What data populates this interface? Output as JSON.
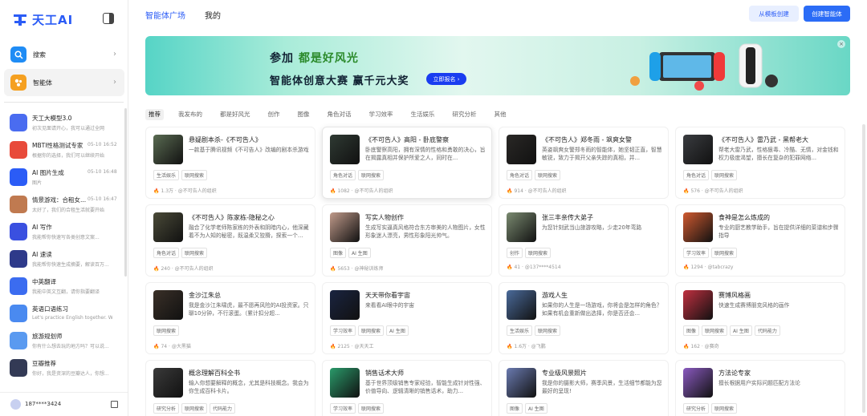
{
  "brand": {
    "name": "天工AI"
  },
  "sidebar": {
    "nav": [
      {
        "label": "搜索",
        "icon": "search-icon",
        "color": "#1f8cf5"
      },
      {
        "label": "智能体",
        "icon": "agent-icon",
        "color": "#f5a020"
      }
    ],
    "chats": [
      {
        "title": "天工大模型3.0",
        "time": "",
        "sub": "初次见面请开心，我可以通过全网",
        "color": "#4a6cf0"
      },
      {
        "title": "MBTI性格测试专家",
        "time": "05-10 16:52",
        "sub": "根据你的选择，我们可以继续开始",
        "color": "#e84a3a"
      },
      {
        "title": "AI 图片生成",
        "time": "05-10 16:48",
        "sub": "图片",
        "color": "#2b5cf6"
      },
      {
        "title": "情景游戏：合租女...",
        "time": "05-10 16:47",
        "sub": "太好了，我们的合租生活就要开始",
        "color": "#c07a50"
      },
      {
        "title": "AI 写作",
        "time": "",
        "sub": "我能帮你快速写各类创意文案...",
        "color": "#3a50e0"
      },
      {
        "title": "AI 速读",
        "time": "",
        "sub": "我能帮你快速生成摘要，解读百万...",
        "color": "#2e3a8a"
      },
      {
        "title": "中英翻译",
        "time": "",
        "sub": "我能中英文互翻，请你指要翻译",
        "color": "#3b6cf0"
      },
      {
        "title": "英语口语练习",
        "time": "",
        "sub": "Let's practice English together. W...",
        "color": "#4a8af0"
      },
      {
        "title": "旅游规划师",
        "time": "",
        "sub": "你有什么想去玩的地方吗？可以说...",
        "color": "#5a9af0"
      },
      {
        "title": "豆瓣推荐",
        "time": "",
        "sub": "你好，我是资深的豆瓣达人，你想...",
        "color": "#333a55"
      }
    ],
    "user": {
      "name": "187****3424"
    }
  },
  "topbar": {
    "tabs": [
      "智能体广场",
      "我的"
    ],
    "tpl_btn": "从模板创建",
    "create_btn": "创建智能体"
  },
  "banner": {
    "line1a": "参加",
    "line1b": "都是好风光",
    "line2": "智能体创意大赛 赢千元大奖",
    "btn": "立即报名 ›",
    "close": "×"
  },
  "categories": [
    "推荐",
    "我发布的",
    "都是好风光",
    "创作",
    "图像",
    "角色对话",
    "学习效率",
    "生活娱乐",
    "研究分析",
    "其他"
  ],
  "cards": [
    {
      "title": "悬疑剧本杀-《不可告人》",
      "desc": "一款基于腾讯视频《不可告人》改编的剧本杀游戏",
      "tags": [
        "生活娱乐",
        "联网搜索"
      ],
      "stats": "1.3万 · @不可告人的组织",
      "color": "#5a6b52"
    },
    {
      "title": "《不可告人》高阳 - 卧底警察",
      "desc": "卧底警察高阳，拥有深情的性格和勇敢的决心，旨在揭露真相并保护所爱之人，同时在...",
      "tags": [
        "角色对话",
        "联网搜索"
      ],
      "stats": "1082 · @不可告人的组织",
      "color": "#2f3a33"
    },
    {
      "title": "《不可告人》郑冬雨 - 飒爽女警",
      "desc": "英姿飒爽女警郑冬雨的智能体，她坚韧正直，智慧敏锐，致力于揭开父亲失踪的真相，并...",
      "tags": [
        "角色对话",
        "联网搜索"
      ],
      "stats": "914 · @不可告人的组织",
      "color": "#2a2826"
    },
    {
      "title": "《不可告人》雷乃武 - 黑帮老大",
      "desc": "帮老大雷乃武，性格狠毒、冷酷、无情，对金钱和权力极度渴望，擅长在复杂的犯罪网络...",
      "tags": [
        "角色对话",
        "联网搜索"
      ],
      "stats": "576 · @不可告人的组织",
      "color": "#3a3c40"
    },
    {
      "title": "《不可告人》陈家栋-隐秘之心",
      "desc": "融合了化学老师陈家栋的外表和阴暗内心，他深藏着不为人知的秘密，既温柔又狡猾，探索一个...",
      "tags": [
        "角色对话",
        "联网搜索"
      ],
      "stats": "240 · @不可告人的组织",
      "color": "#4a4a38"
    },
    {
      "title": "写实人物创作",
      "desc": "生成写实逼真风格符合东方审美的人物图片，女性形象迷人漂亮，男性形象阳光帅气。",
      "tags": [
        "图像",
        "AI 生图"
      ],
      "stats": "5653 · @神秘训练师",
      "color": "#c09a8a"
    },
    {
      "title": "张三丰亲传大弟子",
      "desc": "为您针刻武当山旅游攻略，少走20年弯路",
      "tags": [
        "创作",
        "联网搜索"
      ],
      "stats": "41 · @137****4514",
      "color": "#7a8a70"
    },
    {
      "title": "食神是怎么炼成的",
      "desc": "专业的厨艺教学助手，旨在提供详细的菜谱和步骤指导",
      "tags": [
        "学习效率",
        "联网搜索"
      ],
      "stats": "1294 · @tabcrazy",
      "color": "#d05a30"
    },
    {
      "title": "金沙江朱总",
      "desc": "我是金沙江朱啸虎，最不愿再风险的AI投资家。只聊10分钟，不行滚蛋。（累计扣分超...",
      "tags": [
        "联网搜索"
      ],
      "stats": "74 · @大黑猫",
      "color": "#3a3028"
    },
    {
      "title": "天天带你看宇宙",
      "desc": "来看看AI眼中的宇宙",
      "tags": [
        "学习效率",
        "联网搜索",
        "AI 生图"
      ],
      "stats": "2125 · @天天工",
      "color": "#1a2440"
    },
    {
      "title": "游戏人生",
      "desc": "如果你的人生是一场游戏，你将会是怎样的角色？如果有机会重新做出选择，你是否还会...",
      "tags": [
        "生活娱乐",
        "联网搜索"
      ],
      "stats": "1.6万 · @飞鹏",
      "color": "#4a6a9a"
    },
    {
      "title": "赛博风格画",
      "desc": "快速生成赛博朋克风格的画作",
      "tags": [
        "图像",
        "联网搜索",
        "AI 生图",
        "代码能力"
      ],
      "stats": "162 · @赛奇",
      "color": "#c03040"
    },
    {
      "title": "概念理解百科全书",
      "desc": "输入你想要解释的概念，尤其是科技概念。我会为你生成百科卡片。",
      "tags": [
        "研究分析",
        "联网搜索",
        "代码能力"
      ],
      "stats": "",
      "color": "#3a3a3a"
    },
    {
      "title": "销售话术大师",
      "desc": "基于世界顶级销售专家经验，智能生成针对性强、价值导向、逻辑清晰的销售话术，助力...",
      "tags": [
        "学习效率",
        "联网搜索"
      ],
      "stats": "",
      "color": "#2a9a6a"
    },
    {
      "title": "专业级风景照片",
      "desc": "我是你的摄影大师，赛季风景，生活细节都能为您最好的呈现!",
      "tags": [
        "图像",
        "AI 生图"
      ],
      "stats": "",
      "color": "#6a7ab0"
    },
    {
      "title": "方法论专家",
      "desc": "擅长根据用户实际问题匹配方法论",
      "tags": [
        "研究分析",
        "联网搜索"
      ],
      "stats": "",
      "color": "#8a5ac0"
    }
  ]
}
